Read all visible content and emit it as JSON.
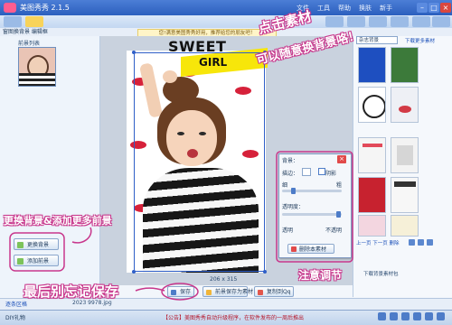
{
  "window": {
    "title": "美图秀秀 2.1.5",
    "menu": [
      "文件",
      "工具",
      "帮助",
      "换肤",
      "新手"
    ]
  },
  "subheader": {
    "doc_tab": "窗图换背景 编辑框",
    "notice": "您!满意美图秀秀好用，推荐给您的朋友吧！"
  },
  "left_panel": {
    "header": "前景列表",
    "change_bg_button": "更换背景",
    "add_fg_button": "添加前景"
  },
  "canvas": {
    "overlay_title": "SWEET",
    "overlay_subtitle": "GIRL",
    "dimensions": "206 x 315"
  },
  "settings_popup": {
    "title": "背景：",
    "border_label": "描边：",
    "shadow_label": "阴影",
    "thin_label": "细",
    "thick_label": "粗",
    "opacity_label": "透明度：",
    "transparent_label": "透明",
    "opaque_label": "不透明",
    "delete_button": "删除本素材"
  },
  "bottom_buttons": {
    "save": "保存",
    "save_as_material": "前景保存为素材",
    "copy": "复制到Qq"
  },
  "right_panel": {
    "category_select": "杂志背景",
    "more_link": "下载更多素材",
    "pager": "上一页 下一页 删除",
    "footer": "下载背景素材包"
  },
  "info_strip": {
    "left": "逐条区格",
    "file": "2023 9978.jpg"
  },
  "status_bar": {
    "left": "DIY礼物",
    "announcement": "【公告】美图秀秀自动升级程序，在软件发布的一周后推出"
  },
  "annotations": {
    "top_right_1": "点击素材",
    "top_right_2": "可以随意换背景咯！",
    "left_mid": "更换背景&添加更多前景",
    "bottom_mid": "注意调节",
    "bottom_left": "最后别忘记保存"
  },
  "colors": {
    "titlebar": "#2b5fbe",
    "annotation_outline": "#c8378c",
    "accent_blue": "#2f5fc8"
  }
}
